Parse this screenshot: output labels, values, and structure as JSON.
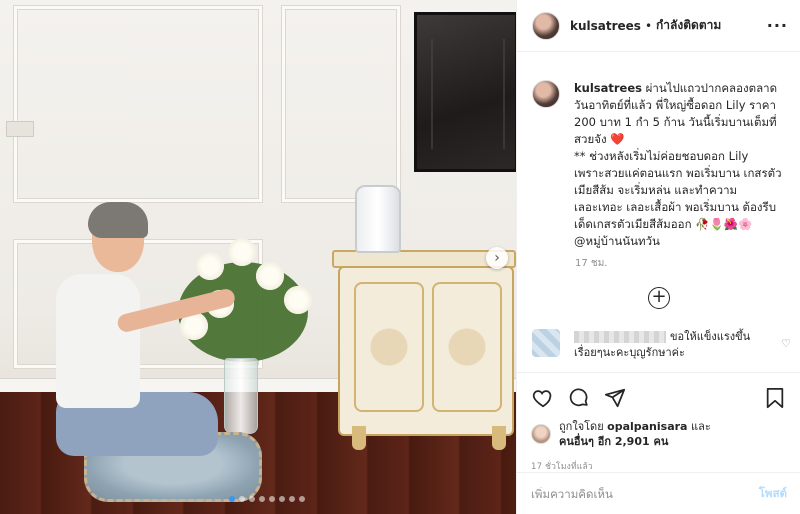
{
  "post": {
    "username": "kulsatrees",
    "separator": "•",
    "following_label": "กำลังติดตาม",
    "more_label": "···",
    "carousel_next": "›",
    "carousel_total": 8,
    "carousel_active": 0,
    "caption": {
      "username": "kulsatrees",
      "text": "ผ่านไปแถวปากคลองตลาดวันอาทิตย์ที่แล้ว พี่ใหญ่ซื้อดอก Lily ราคา 200 บาท 1 กำ 5 ก้าน วันนี้เริ่มบานเต็มที่สวยจัง ❤️\n** ช่วงหลังเริ่มไม่ค่อยชอบดอก Lily เพราะสวยแค่ตอนแรก พอเริ่มบาน เกสรตัวเมียสีส้ม จะเริ่มหล่น และทำความเลอะเทอะ เลอะเสื้อผ้า พอเริ่มบาน ต้องรีบเด็ดเกสรตัวเมียสีส้มออก 🥀🌷🌺🌸 @หมู่บ้านนันทวัน",
      "time": "17 ชม."
    },
    "load_more_icon": "+",
    "comment": {
      "text": "ขอให้แข็งแรงขึ้นเรื่อยๆนะคะบุญรักษาค่ะ",
      "like_icon": "♡"
    },
    "likes": {
      "prefix": "ถูกใจโดย",
      "liked_by": "opalpanisara",
      "and": "และ",
      "others": "คนอื่นๆ อีก 2,901 คน"
    },
    "time_ago": "17 ชั่วโมงที่แล้ว",
    "add_comment": {
      "placeholder": "เพิ่มความคิดเห็น",
      "post_label": "โพสต์"
    }
  },
  "colors": {
    "link_blue": "#3897f0",
    "post_button_disabled": "#b3dbff",
    "heart_red": "#ed4956"
  }
}
